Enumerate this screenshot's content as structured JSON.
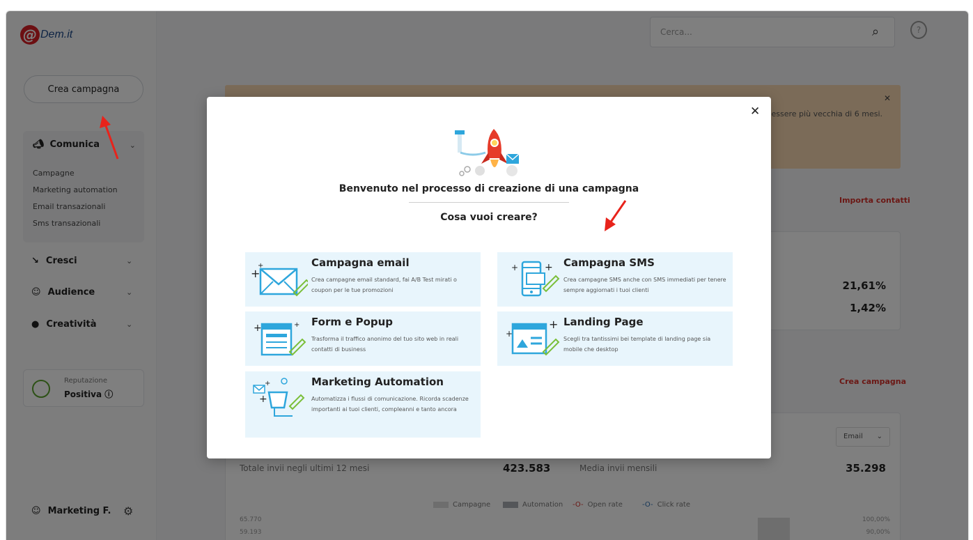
{
  "logo": {
    "text": "Dem.it",
    "mark": "@"
  },
  "sidebar": {
    "create_button": "Crea campagna",
    "comunica": {
      "label": "Comunica",
      "items": [
        "Campagne",
        "Marketing automation",
        "Email transazionali",
        "Sms transazionali"
      ]
    },
    "nav": [
      {
        "label": "Cresci",
        "icon": "megaphone-icon"
      },
      {
        "label": "Audience",
        "icon": "people-icon"
      },
      {
        "label": "Creatività",
        "icon": "palette-icon"
      }
    ],
    "reputation": {
      "label": "Reputazione",
      "value": "Positiva"
    },
    "user": {
      "name": "Marketing F."
    }
  },
  "header": {
    "search_placeholder": "Cerca..."
  },
  "background": {
    "alert_text": "essere più vecchia di 6 mesi.",
    "importa_link": "Importa contatti",
    "stat1": "21,61%",
    "stat2": "1,42%",
    "crea_link": "Crea campagna",
    "dropdown": "Email",
    "total_label": "Totale invii negli ultimi 12 mesi",
    "total_value": "423.583",
    "monthly_label": "Media invii mensili",
    "monthly_value": "35.298",
    "legend": [
      "Campagne",
      "Automation",
      "Open rate",
      "Click rate"
    ],
    "y_left": [
      "65.770",
      "59.193"
    ],
    "y_right": [
      "100,00%",
      "90,00%"
    ]
  },
  "modal": {
    "title": "Benvenuto nel processo di creazione di una campagna",
    "subtitle": "Cosa vuoi creare?",
    "options": [
      {
        "title": "Campagna email",
        "desc": "Crea campagne email standard, fai A/B Test mirati o coupon per le tue promozioni",
        "icon": "envelope-icon"
      },
      {
        "title": "Campagna SMS",
        "desc": "Crea campagne SMS anche con SMS immediati per tenere sempre aggiornati i tuoi clienti",
        "icon": "smartphone-icon"
      },
      {
        "title": "Form e Popup",
        "desc": "Trasforma il traffico anonimo del tuo sito web in reali contatti di business",
        "icon": "form-icon"
      },
      {
        "title": "Landing Page",
        "desc": "Scegli tra tantissimi bei template di landing page sia mobile che desktop",
        "icon": "landing-page-icon"
      },
      {
        "title": "Marketing Automation",
        "desc": "Automatizza i flussi di comunicazione. Ricorda scadenze importanti ai tuoi clienti, compleanni e tanto ancora",
        "icon": "automation-icon"
      }
    ]
  },
  "colors": {
    "accent": "#d7302a",
    "option_bg": "#e8f5fc",
    "icon_blue": "#2ea6dc",
    "icon_green": "#7bbf3a"
  }
}
